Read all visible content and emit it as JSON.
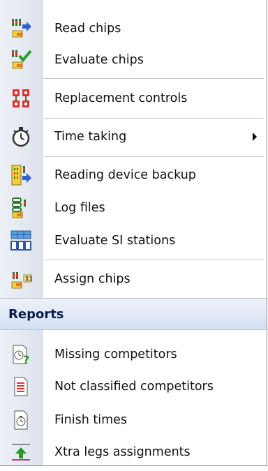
{
  "menu": {
    "items": [
      {
        "label": "Read chips",
        "icon": "read-chips-icon"
      },
      {
        "label": "Evaluate chips",
        "icon": "evaluate-chips-icon"
      },
      {
        "label": "Replacement controls",
        "icon": "replacement-controls-icon"
      },
      {
        "label": "Time taking",
        "icon": "stopwatch-icon",
        "submenu": true
      },
      {
        "label": "Reading device backup",
        "icon": "device-backup-icon"
      },
      {
        "label": "Log files",
        "icon": "log-files-icon"
      },
      {
        "label": "Evaluate SI stations",
        "icon": "si-stations-icon"
      },
      {
        "label": "Assign chips",
        "icon": "assign-chips-icon"
      }
    ],
    "reports": {
      "title": "Reports",
      "items": [
        {
          "label": "Missing competitors",
          "icon": "missing-competitors-icon"
        },
        {
          "label": "Not classified competitors",
          "icon": "not-classified-icon"
        },
        {
          "label": "Finish times",
          "icon": "finish-times-icon"
        },
        {
          "label": "Xtra legs assignments",
          "icon": "xtra-legs-icon"
        }
      ]
    }
  },
  "colors": {
    "header_text": "#0a1f4a",
    "header_bg": "#dbe4f3",
    "gutter": "#e4e9f1"
  }
}
